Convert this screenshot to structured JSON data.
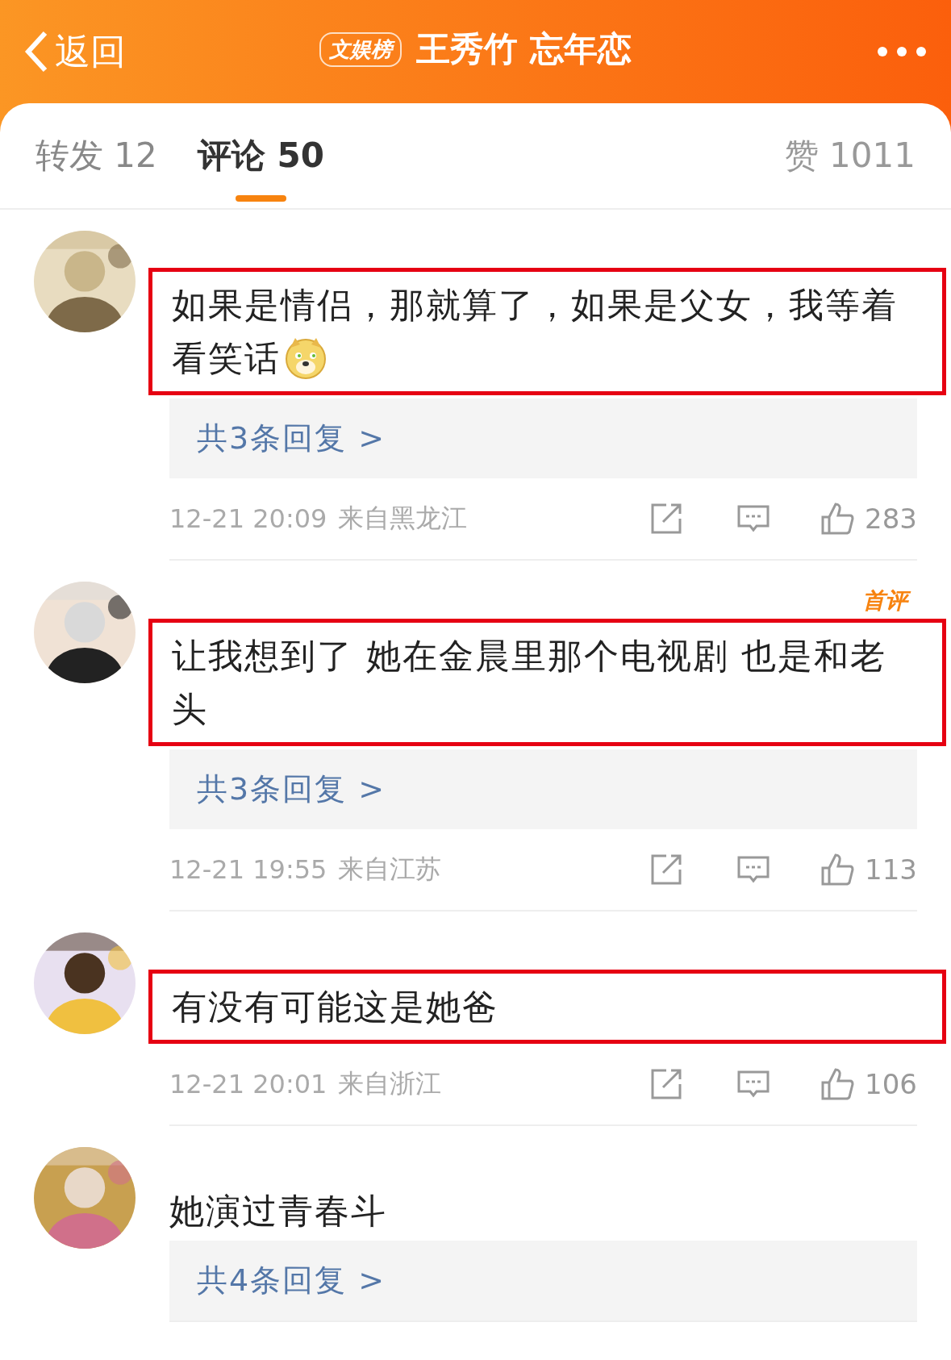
{
  "header": {
    "back": "返回",
    "badge": "文娱榜",
    "title": "王秀竹 忘年恋"
  },
  "tabs": [
    {
      "label": "转发 12",
      "selected": false
    },
    {
      "label": "评论 50",
      "selected": true
    }
  ],
  "likes_tab": "赞 1011",
  "comments": [
    {
      "text": "如果是情侣，那就算了，如果是父女，我等着看笑话",
      "emoji": true,
      "highlighted": true,
      "replies": "共3条回复 >",
      "time": "12-21 20:09",
      "location": "来自黑龙江",
      "likes": "283"
    },
    {
      "text": "让我想到了 她在金晨里那个电视剧  也是和老头",
      "emoji": false,
      "highlighted": true,
      "badge": "首评",
      "replies": "共3条回复 >",
      "time": "12-21 19:55",
      "location": "来自江苏",
      "likes": "113"
    },
    {
      "text": "有没有可能这是她爸",
      "emoji": false,
      "highlighted": true,
      "time": "12-21 20:01",
      "location": "来自浙江",
      "likes": "106"
    },
    {
      "text": "她演过青春斗",
      "emoji": false,
      "highlighted": false,
      "replies": "共4条回复 >"
    }
  ]
}
